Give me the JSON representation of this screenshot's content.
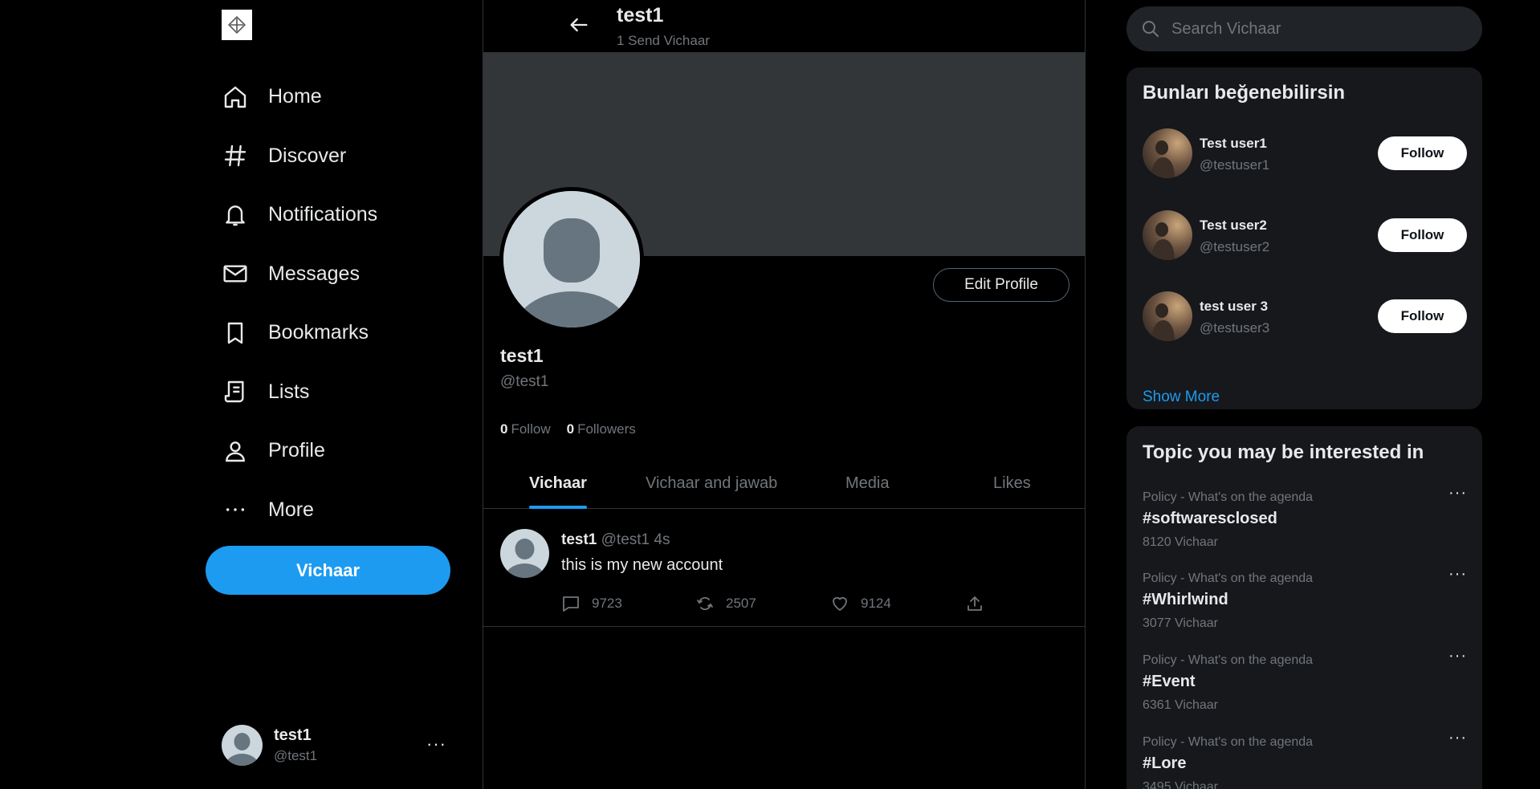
{
  "sidebar": {
    "logo_icon": "brand-logo-icon",
    "items": [
      {
        "label": "Home",
        "icon": "home-icon"
      },
      {
        "label": "Discover",
        "icon": "hashtag-icon"
      },
      {
        "label": "Notifications",
        "icon": "bell-icon"
      },
      {
        "label": "Messages",
        "icon": "envelope-icon"
      },
      {
        "label": "Bookmarks",
        "icon": "bookmark-icon"
      },
      {
        "label": "Lists",
        "icon": "list-icon"
      },
      {
        "label": "Profile",
        "icon": "person-icon"
      },
      {
        "label": "More",
        "icon": "more-dots-icon"
      }
    ],
    "post_button_label": "Vichaar",
    "account": {
      "name": "test1",
      "handle": "@test1",
      "menu": "···"
    }
  },
  "header": {
    "title": "test1",
    "subtitle": "1 Send Vichaar"
  },
  "profile": {
    "name": "test1",
    "handle": "@test1",
    "edit_label": "Edit Profile",
    "follow_count": "0",
    "follow_label": "Follow",
    "followers_count": "0",
    "followers_label": "Followers"
  },
  "tabs": [
    {
      "label": "Vichaar",
      "active": true
    },
    {
      "label": "Vichaar and jawab",
      "active": false
    },
    {
      "label": "Media",
      "active": false
    },
    {
      "label": "Likes",
      "active": false
    }
  ],
  "post": {
    "name": "test1",
    "meta": "@test1 4s",
    "text": "this is my new account",
    "replies": "9723",
    "reposts": "2507",
    "likes": "9124"
  },
  "search": {
    "placeholder": "Search Vichaar"
  },
  "suggestions": {
    "title": "Bunları beğenebilirsin",
    "users": [
      {
        "name": "Test user1",
        "handle": "@testuser1",
        "button": "Follow"
      },
      {
        "name": "Test user2",
        "handle": "@testuser2",
        "button": "Follow"
      },
      {
        "name": "test user 3",
        "handle": "@testuser3",
        "button": "Follow"
      }
    ],
    "show_more": "Show More"
  },
  "topics": {
    "title": "Topic you may be interested in",
    "items": [
      {
        "category": "Policy - What's on the agenda",
        "tag": "#softwaresclosed",
        "count": "8120 Vichaar"
      },
      {
        "category": "Policy - What's on the agenda",
        "tag": "#Whirlwind",
        "count": "3077 Vichaar"
      },
      {
        "category": "Policy - What's on the agenda",
        "tag": "#Event",
        "count": "6361 Vichaar"
      },
      {
        "category": "Policy - What's on the agenda",
        "tag": "#Lore",
        "count": "3495 Vichaar"
      }
    ],
    "menu": "···"
  },
  "colors": {
    "accent": "#1d9bf0",
    "background": "#000000",
    "card": "#16181c",
    "muted": "#71767b"
  }
}
